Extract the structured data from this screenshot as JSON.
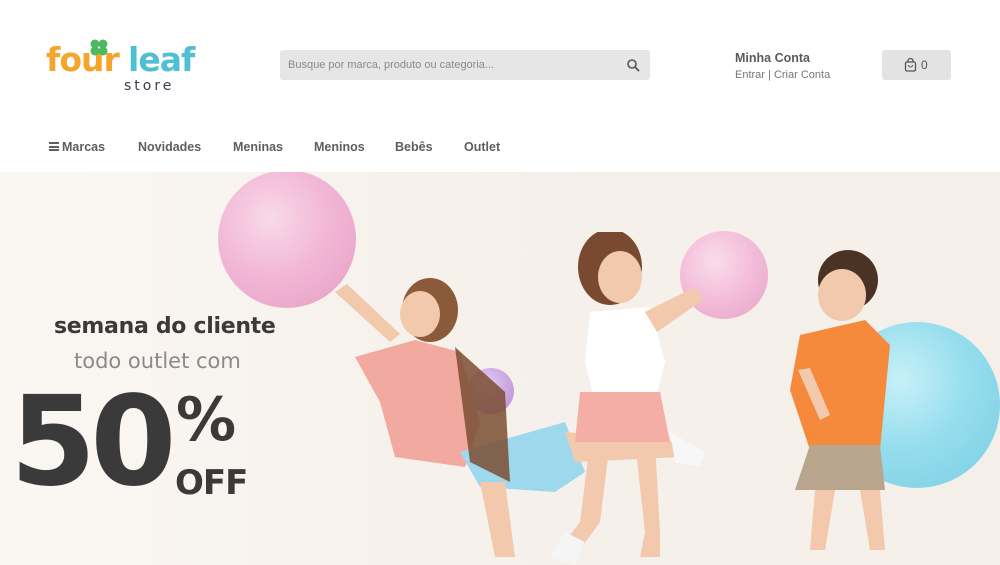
{
  "logo": {
    "letters": [
      {
        "ch": "f",
        "color": "#f4a62a"
      },
      {
        "ch": "o",
        "color": "#f4a62a"
      },
      {
        "ch": "u",
        "color": "#f4a62a"
      },
      {
        "ch": "r",
        "color": "#f4a62a"
      },
      {
        "ch": "l",
        "color": "#4fc0d1"
      },
      {
        "ch": "e",
        "color": "#4fc0d1"
      },
      {
        "ch": "a",
        "color": "#4fc0d1"
      },
      {
        "ch": "f",
        "color": "#4fc0d1"
      }
    ],
    "store": "store",
    "clover_color": "#4cb85f"
  },
  "search": {
    "placeholder": "Busque por marca, produto ou categoria..."
  },
  "account": {
    "title": "Minha Conta",
    "login": "Entrar",
    "separator": "|",
    "register": "Criar Conta"
  },
  "cart": {
    "count": "0"
  },
  "nav": {
    "items": [
      "Marcas",
      "Novidades",
      "Meninas",
      "Meninos",
      "Bebês",
      "Outlet"
    ]
  },
  "banner": {
    "line1": "semana do cliente",
    "line2": "todo outlet com",
    "discount": "50",
    "percent": "%",
    "off": "OFF"
  },
  "colors": {
    "text_dark": "#3a3a3a",
    "balloon_pink": "#f2b8d6",
    "balloon_blue": "#8fd9ea",
    "balloon_purple": "#c9a3e0"
  }
}
